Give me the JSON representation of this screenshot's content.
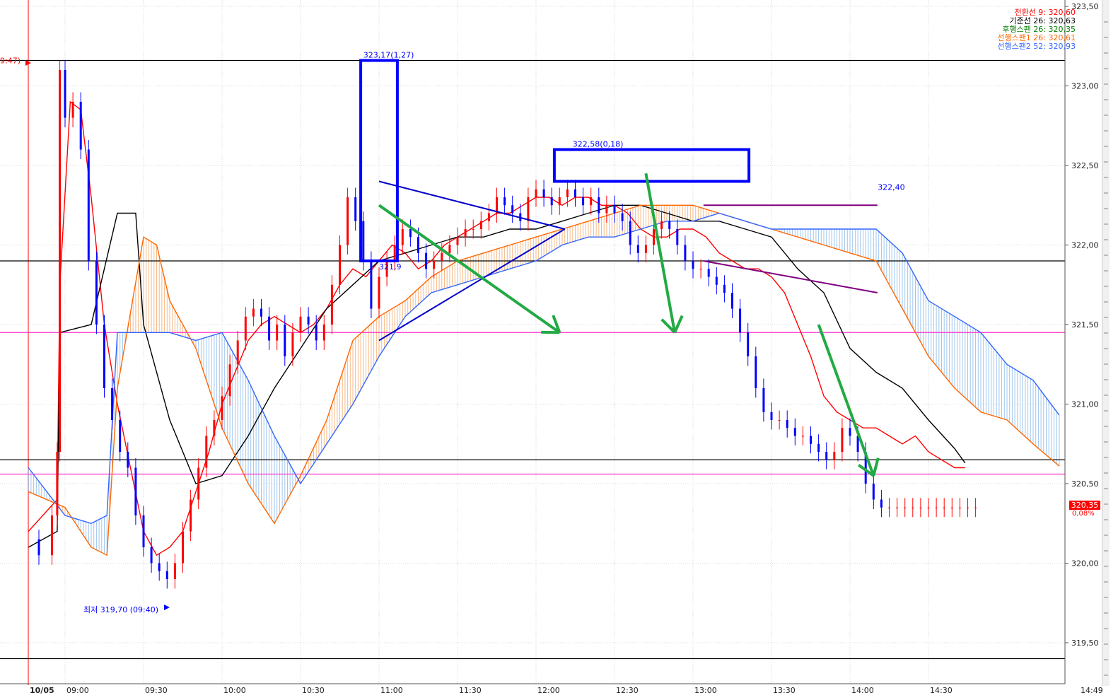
{
  "legend": [
    {
      "label": "전환선 9: 320,60",
      "color": "#ff0000"
    },
    {
      "label": "기준선 26: 320,63",
      "color": "#000000"
    },
    {
      "label": "후행스팬 26: 320,35",
      "color": "#008000"
    },
    {
      "label": "선행스팬1 26: 320,61",
      "color": "#ff6600"
    },
    {
      "label": "선행스팬2 52: 320,93",
      "color": "#3366ff"
    }
  ],
  "last_price": {
    "value": "320,35",
    "change": "0,08%"
  },
  "annotations": {
    "high_box_label": "323,17(1,27)",
    "top_box_label": "322,58(0,18)",
    "box_price": "322,40",
    "low_label": "최저 319,70 (09:40)",
    "first_bar_label": "321,9",
    "left_marker": "9:47)"
  },
  "chart_data": {
    "type": "line",
    "title": "",
    "xlabel": "",
    "ylabel": "",
    "date": "10/05",
    "ylim": [
      319.3,
      323.55
    ],
    "y_ticks": [
      {
        "v": 323.5,
        "label": "323,50"
      },
      {
        "v": 323.0,
        "label": "323,00"
      },
      {
        "v": 322.5,
        "label": "322,50"
      },
      {
        "v": 322.0,
        "label": "322,00"
      },
      {
        "v": 321.5,
        "label": "321,50"
      },
      {
        "v": 321.0,
        "label": "321,00"
      },
      {
        "v": 320.5,
        "label": "320,50"
      },
      {
        "v": 320.0,
        "label": "320,00"
      },
      {
        "v": 319.5,
        "label": "319,50"
      }
    ],
    "x_ticks": [
      {
        "t": "08:57",
        "label": "10/05"
      },
      {
        "t": "09:00",
        "label": "09:00"
      },
      {
        "t": "09:30",
        "label": "09:30"
      },
      {
        "t": "10:00",
        "label": "10:00"
      },
      {
        "t": "10:30",
        "label": "10:30"
      },
      {
        "t": "11:00",
        "label": "11:00"
      },
      {
        "t": "11:30",
        "label": "11:30"
      },
      {
        "t": "12:00",
        "label": "12:00"
      },
      {
        "t": "12:30",
        "label": "12:30"
      },
      {
        "t": "13:00",
        "label": "13:00"
      },
      {
        "t": "13:30",
        "label": "13:30"
      },
      {
        "t": "14:00",
        "label": "14:00"
      },
      {
        "t": "14:30",
        "label": "14:30"
      },
      {
        "t": "14:49",
        "label": "14:49"
      }
    ],
    "hlines_black": [
      323.16,
      321.9,
      320.65,
      319.4
    ],
    "hlines_magenta": [
      321.45,
      320.56
    ],
    "price": {
      "t": [
        "08:46",
        "08:50",
        "08:55",
        "08:57",
        "08:58",
        "09:00",
        "09:03",
        "09:06",
        "09:09",
        "09:12",
        "09:15",
        "09:18",
        "09:21",
        "09:24",
        "09:27",
        "09:30",
        "09:33",
        "09:36",
        "09:39",
        "09:42",
        "09:45",
        "09:48",
        "09:51",
        "09:54",
        "09:57",
        "10:00",
        "10:03",
        "10:06",
        "10:09",
        "10:12",
        "10:15",
        "10:18",
        "10:21",
        "10:24",
        "10:27",
        "10:30",
        "10:33",
        "10:36",
        "10:39",
        "10:42",
        "10:45",
        "10:48",
        "10:51",
        "10:54",
        "10:57",
        "11:00",
        "11:03",
        "11:06",
        "11:09",
        "11:12",
        "11:15",
        "11:18",
        "11:21",
        "11:24",
        "11:27",
        "11:30",
        "11:33",
        "11:36",
        "11:39",
        "11:42",
        "11:45",
        "11:48",
        "11:51",
        "11:54",
        "11:57",
        "12:00",
        "12:03",
        "12:06",
        "12:09",
        "12:12",
        "12:15",
        "12:18",
        "12:21",
        "12:24",
        "12:27",
        "12:30",
        "12:33",
        "12:36",
        "12:39",
        "12:42",
        "12:45",
        "12:48",
        "12:51",
        "12:54",
        "12:57",
        "13:00",
        "13:03",
        "13:06",
        "13:09",
        "13:12",
        "13:15",
        "13:18",
        "13:21",
        "13:24",
        "13:27",
        "13:30",
        "13:33",
        "13:36",
        "13:39",
        "13:42",
        "13:45",
        "13:48",
        "13:51",
        "13:54",
        "13:57",
        "14:00",
        "14:03",
        "14:06",
        "14:09",
        "14:12",
        "14:15",
        "14:18",
        "14:21",
        "14:24",
        "14:27",
        "14:30",
        "14:33",
        "14:36",
        "14:39",
        "14:42",
        "14:45",
        "14:48"
      ],
      "close": [
        320.15,
        320.05,
        320.3,
        320.7,
        323.1,
        322.8,
        322.9,
        322.6,
        321.9,
        321.5,
        321.1,
        320.9,
        320.7,
        320.6,
        320.3,
        320.1,
        320.0,
        319.95,
        319.9,
        320.0,
        320.2,
        320.4,
        320.6,
        320.8,
        320.9,
        321.05,
        321.25,
        321.4,
        321.55,
        321.6,
        321.55,
        321.4,
        321.5,
        321.3,
        321.45,
        321.55,
        321.5,
        321.4,
        321.5,
        321.75,
        322.0,
        322.3,
        322.15,
        321.9,
        321.6,
        321.8,
        321.9,
        322.0,
        322.1,
        322.05,
        321.95,
        321.85,
        321.9,
        321.95,
        322.0,
        322.05,
        322.1,
        322.1,
        322.15,
        322.2,
        322.3,
        322.25,
        322.2,
        322.15,
        322.3,
        322.35,
        322.3,
        322.25,
        322.3,
        322.35,
        322.3,
        322.25,
        322.3,
        322.2,
        322.25,
        322.2,
        322.15,
        322.0,
        321.95,
        322.0,
        322.1,
        322.15,
        322.1,
        322.0,
        321.9,
        321.85,
        321.85,
        321.8,
        321.75,
        321.7,
        321.6,
        321.45,
        321.3,
        321.1,
        320.95,
        320.9,
        320.9,
        320.85,
        320.8,
        320.8,
        320.75,
        320.7,
        320.65,
        320.7,
        320.85,
        320.8,
        320.7,
        320.5,
        320.4,
        320.35,
        320.35,
        320.35,
        320.35,
        320.35,
        320.35,
        320.35,
        320.35,
        320.35,
        320.35,
        320.35,
        320.35,
        320.35
      ]
    },
    "series": [
      {
        "key": "tenkan",
        "color": "#ff0000",
        "t": [
          "08:46",
          "08:57",
          "08:58",
          "09:02",
          "09:06",
          "09:10",
          "09:15",
          "09:20",
          "09:25",
          "09:30",
          "09:35",
          "09:40",
          "09:45",
          "09:50",
          "09:55",
          "10:00",
          "10:05",
          "10:10",
          "10:15",
          "10:20",
          "10:25",
          "10:30",
          "10:35",
          "10:40",
          "10:45",
          "10:50",
          "10:55",
          "11:00",
          "11:05",
          "11:10",
          "11:15",
          "11:20",
          "11:25",
          "11:30",
          "11:35",
          "11:40",
          "11:45",
          "11:50",
          "11:55",
          "12:00",
          "12:05",
          "12:10",
          "12:15",
          "12:20",
          "12:25",
          "12:30",
          "12:35",
          "12:40",
          "12:45",
          "12:50",
          "12:55",
          "13:00",
          "13:05",
          "13:10",
          "13:15",
          "13:20",
          "13:25",
          "13:30",
          "13:35",
          "13:40",
          "13:45",
          "13:50",
          "13:55",
          "14:00",
          "14:05",
          "14:10",
          "14:15",
          "14:20",
          "14:25",
          "14:30",
          "14:35",
          "14:40",
          "14:44"
        ],
        "v": [
          320.2,
          320.4,
          321.75,
          322.9,
          322.85,
          322.3,
          321.5,
          321.0,
          320.6,
          320.2,
          320.05,
          320.1,
          320.2,
          320.45,
          320.7,
          321.0,
          321.2,
          321.4,
          321.5,
          321.55,
          321.5,
          321.45,
          321.5,
          321.6,
          321.75,
          321.85,
          321.8,
          321.9,
          322.0,
          321.95,
          321.85,
          321.9,
          322.0,
          322.05,
          322.1,
          322.15,
          322.2,
          322.2,
          322.25,
          322.3,
          322.3,
          322.25,
          322.3,
          322.3,
          322.25,
          322.25,
          322.2,
          322.1,
          322.05,
          322.05,
          322.1,
          322.1,
          322.05,
          321.95,
          321.9,
          321.85,
          321.85,
          321.8,
          321.7,
          321.5,
          321.3,
          321.05,
          320.95,
          320.9,
          320.85,
          320.85,
          320.8,
          320.75,
          320.8,
          320.7,
          320.65,
          320.6,
          320.6
        ]
      },
      {
        "key": "kijun",
        "color": "#000000",
        "t": [
          "08:46",
          "08:57",
          "08:58",
          "09:10",
          "09:20",
          "09:27",
          "09:30",
          "09:40",
          "09:50",
          "10:00",
          "10:10",
          "10:20",
          "10:30",
          "10:40",
          "10:50",
          "11:00",
          "11:10",
          "11:20",
          "11:30",
          "11:40",
          "11:50",
          "12:00",
          "12:10",
          "12:20",
          "12:30",
          "12:40",
          "12:50",
          "13:00",
          "13:10",
          "13:20",
          "13:30",
          "13:40",
          "13:50",
          "14:00",
          "14:10",
          "14:20",
          "14:30",
          "14:40",
          "14:44"
        ],
        "v": [
          320.1,
          320.2,
          321.45,
          321.5,
          322.2,
          322.2,
          321.5,
          320.9,
          320.5,
          320.55,
          320.8,
          321.1,
          321.35,
          321.6,
          321.75,
          321.9,
          321.95,
          322.0,
          322.05,
          322.05,
          322.1,
          322.1,
          322.15,
          322.2,
          322.25,
          322.25,
          322.2,
          322.15,
          322.15,
          322.1,
          322.05,
          321.85,
          321.7,
          321.35,
          321.2,
          321.1,
          320.9,
          320.72,
          320.63
        ]
      },
      {
        "key": "senkou_a",
        "color": "#ff6600",
        "t": [
          "08:46",
          "09:00",
          "09:10",
          "09:16",
          "09:20",
          "09:30",
          "09:35",
          "09:40",
          "09:50",
          "10:00",
          "10:10",
          "10:20",
          "10:30",
          "10:40",
          "10:50",
          "11:00",
          "11:10",
          "11:20",
          "11:30",
          "11:40",
          "11:50",
          "12:00",
          "12:10",
          "12:20",
          "12:30",
          "12:40",
          "12:50",
          "13:00",
          "13:10",
          "13:20",
          "13:30",
          "13:40",
          "13:50",
          "14:00",
          "14:10",
          "14:20",
          "14:30",
          "14:40",
          "14:50",
          "15:00",
          "15:10",
          "15:20"
        ],
        "v": [
          320.45,
          320.35,
          320.1,
          320.05,
          321.1,
          322.05,
          322.0,
          321.65,
          321.35,
          320.85,
          320.5,
          320.25,
          320.55,
          320.9,
          321.4,
          321.55,
          321.65,
          321.8,
          321.9,
          321.95,
          322.0,
          322.05,
          322.1,
          322.15,
          322.2,
          322.25,
          322.25,
          322.25,
          322.2,
          322.15,
          322.1,
          322.05,
          322.0,
          321.95,
          321.9,
          321.6,
          321.3,
          321.1,
          320.95,
          320.9,
          320.75,
          320.61
        ]
      },
      {
        "key": "senkou_b",
        "color": "#3366ff",
        "t": [
          "08:46",
          "09:00",
          "09:10",
          "09:16",
          "09:20",
          "09:30",
          "09:40",
          "09:50",
          "10:00",
          "10:10",
          "10:20",
          "10:30",
          "10:40",
          "10:50",
          "11:00",
          "11:10",
          "11:20",
          "11:30",
          "11:40",
          "11:50",
          "12:00",
          "12:10",
          "12:20",
          "12:30",
          "12:40",
          "12:50",
          "13:00",
          "13:10",
          "13:20",
          "13:30",
          "13:40",
          "13:50",
          "14:00",
          "14:10",
          "14:20",
          "14:30",
          "14:40",
          "14:50",
          "15:00",
          "15:10",
          "15:20"
        ],
        "v": [
          320.6,
          320.3,
          320.25,
          320.3,
          321.45,
          321.45,
          321.45,
          321.4,
          321.45,
          321.15,
          320.8,
          320.5,
          320.75,
          321.0,
          321.3,
          321.55,
          321.7,
          321.75,
          321.8,
          321.85,
          321.9,
          322.0,
          322.05,
          322.05,
          322.1,
          322.15,
          322.15,
          322.2,
          322.15,
          322.1,
          322.1,
          322.1,
          322.1,
          322.1,
          321.95,
          321.65,
          321.55,
          321.45,
          321.25,
          321.15,
          320.93
        ]
      }
    ]
  }
}
